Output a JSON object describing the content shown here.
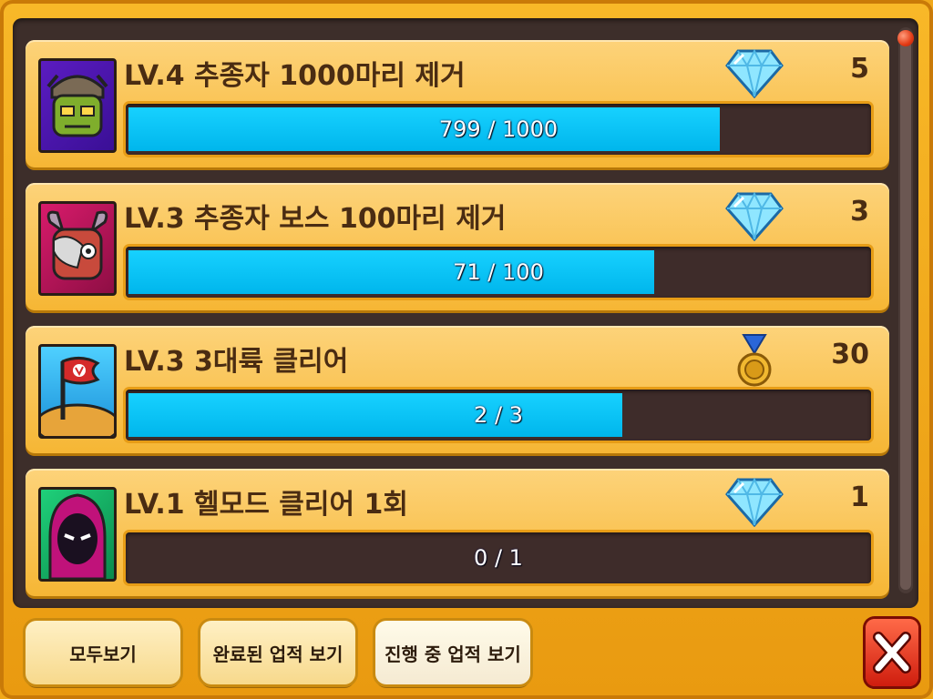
{
  "achievements": [
    {
      "title": "LV.4 추종자 1000마리 제거",
      "reward_icon": "diamond-icon",
      "reward": "5",
      "progress_text": "799 / 1000",
      "progress": 0.799
    },
    {
      "title": "LV.3 추종자 보스 100마리 제거",
      "reward_icon": "diamond-icon",
      "reward": "3",
      "progress_text": "71 / 100",
      "progress": 0.71
    },
    {
      "title": "LV.3 3대륙 클리어",
      "reward_icon": "medal-icon",
      "reward": "30",
      "progress_text": "2 / 3",
      "progress": 0.667
    },
    {
      "title": "LV.1 헬모드 클리어 1회",
      "reward_icon": "diamond-icon",
      "reward": "1",
      "progress_text": "0 / 1",
      "progress": 0.0
    }
  ],
  "filters": {
    "all": "모두보기",
    "completed": "완료된 업적 보기",
    "in_progress": "진행 중 업적 보기",
    "active": "in_progress"
  },
  "colors": {
    "progress_fill": "#00c2f3",
    "panel_bg": "#3d2e2a",
    "frame": "#f0a81a",
    "close_button": "#e43a1c"
  }
}
